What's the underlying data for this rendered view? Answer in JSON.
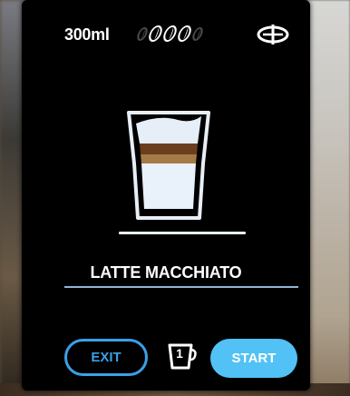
{
  "status": {
    "volume": "300ml",
    "strength_level": 3,
    "strength_max": 5,
    "strength_icon": "coffee-bean-icon",
    "options_icon": "drink-options-icon"
  },
  "drink": {
    "name": "LATTE MACCHIATO",
    "icon": "latte-glass-icon"
  },
  "controls": {
    "exit_label": "EXIT",
    "cups": "1",
    "cup_icon": "cup-icon",
    "start_label": "START"
  },
  "colors": {
    "screen_bg": "#000000",
    "accent": "#3aa0e6",
    "start_fill": "#52c1f5",
    "text": "#ffffff"
  }
}
